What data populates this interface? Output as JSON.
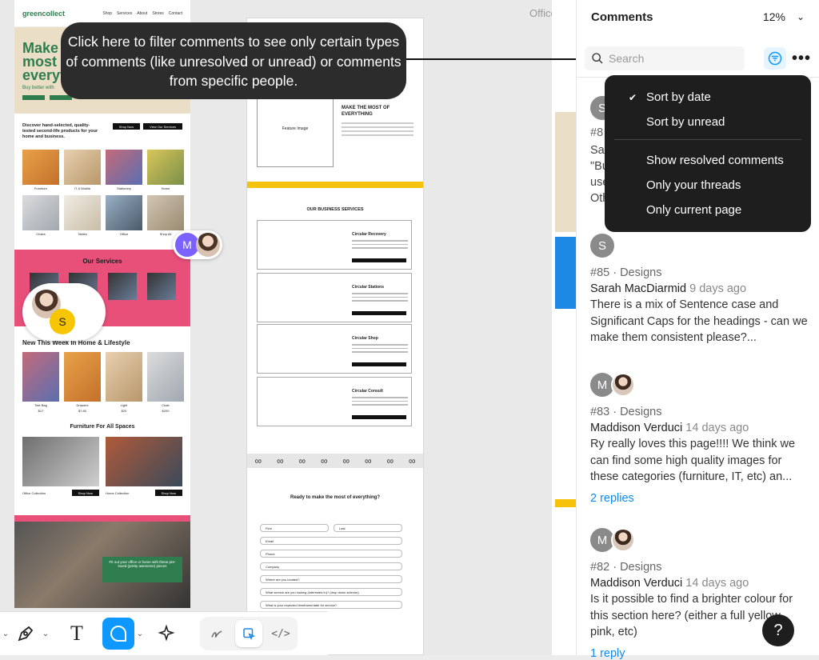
{
  "tooltip": {
    "text": "Click here to filter comments to see only certain types of comments (like unresolved or unread) or comments from specific people."
  },
  "canvas": {
    "frame_label": "Office C",
    "greencollect": {
      "logo": "greencollect",
      "nav": [
        "Shop",
        "Services",
        "About",
        "Stores",
        "Contact"
      ],
      "hero_title": "Make the most of everyth",
      "hero_sub": "Buy better with",
      "discover": "Discover hand-selected, quality-tested second-life products for your home and business.",
      "discover_buttons": [
        "Shop Now",
        "View Our Services"
      ],
      "categories": [
        "Furniture",
        "IT & Mobile",
        "Stationery",
        "Home",
        "Chairs",
        "Tables",
        "Office",
        "Shop All"
      ],
      "services_title": "Our Services",
      "new_in": "New This Week In Home & Lifestyle",
      "new_items": [
        {
          "name": "Tote Bag",
          "price": "$17"
        },
        {
          "name": "Drawers",
          "price": "$7.80"
        },
        {
          "name": "Light",
          "price": "$20"
        },
        {
          "name": "Chair",
          "price": "$200"
        }
      ],
      "furniture_title": "Furniture For All Spaces",
      "furniture_caps": [
        "Office Collection",
        "Home Collection"
      ],
      "shop_now": "Shop Now",
      "green_card": "Fit out your office or home with these pre-loved (pretty awesome) pieces"
    },
    "wireframe": {
      "feature_image": "Feature Image",
      "make_title": "MAKE THE MOST OF EVERYTHING",
      "business_title": "OUR BUSINESS SERVICES",
      "cards": [
        "Circular Recovery",
        "Circular Stations",
        "Circular Shop",
        "Circular Consult"
      ],
      "ready_title": "Ready to make the most of everything?",
      "fields": [
        "First",
        "Last",
        "Email",
        "Phone",
        "Company",
        "Where are you located?",
        "What service are you looking (interested in)? (drop down selector)",
        "What is your expected timeframe/date for service?"
      ]
    }
  },
  "avatars": {
    "m_letter": "M",
    "s_letter": "S"
  },
  "toolbar": {
    "tools": [
      "pen-tool",
      "text-tool",
      "comment-tool",
      "ai-tool"
    ],
    "text_glyph": "T",
    "dev_glyph": "</>"
  },
  "panel": {
    "title": "Comments",
    "zoom": "12%",
    "search_placeholder": "Search",
    "sort_menu": {
      "items": [
        "Sort by date",
        "Sort by unread"
      ],
      "selected": "Sort by date",
      "filters": [
        "Show resolved comments",
        "Only your threads",
        "Only current page"
      ]
    },
    "partial_comment": {
      "meta": "#8",
      "lines": [
        "Sa",
        "\"Bu",
        "use",
        "Oth"
      ]
    },
    "comments": [
      {
        "avatar_letter": "S",
        "id_meta": "#85 · Designs",
        "author": "Sarah MacDiarmid",
        "when": "9 days ago",
        "body": "There is a mix of Sentence case and Significant Caps for the headings - can we make them consistent please?...",
        "replies": ""
      },
      {
        "avatar_letter": "M",
        "id_meta": "#83 · Designs",
        "author": "Maddison Verduci",
        "when": "14 days ago",
        "body": "Ry really loves this page!!!! We think we can find some high quality images for these categories (furniture, IT, etc) an...",
        "replies": "2 replies"
      },
      {
        "avatar_letter": "M",
        "id_meta": "#82 · Designs",
        "author": "Maddison Verduci",
        "when": "14 days ago",
        "body": "Is it possible to find a brighter colour for this section here? (either a full yellow, pink, etc)",
        "replies": "1 reply"
      }
    ],
    "help": "?"
  },
  "colors": {
    "accent": "#0d99ff",
    "brand_green": "#2f7d4f",
    "brand_pink": "#e8507a",
    "tooltip_bg": "#2c2c2c"
  }
}
